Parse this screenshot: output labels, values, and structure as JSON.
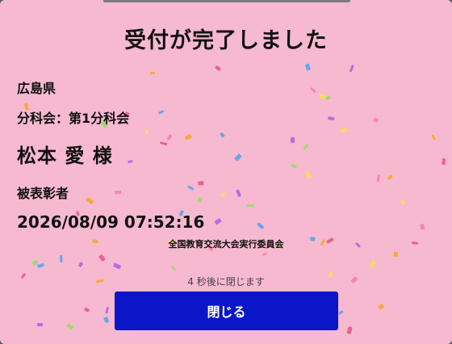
{
  "dialog": {
    "title": "受付が完了しました",
    "prefecture": "広島県",
    "section": "分科会：第1分科会",
    "name": "松本 愛 様",
    "award": "被表彰者",
    "datetime": "2026/08/09 07:52:16",
    "organizer": "全国教育交流大会実行委員会",
    "countdown": "4 秒後に閉じます",
    "close_label": "閉じる"
  },
  "colors": {
    "background": "#f7b9d0",
    "button": "#0a16c8",
    "confetti": [
      "#f5a623",
      "#e94f8a",
      "#4aa3f0",
      "#b05ce8",
      "#8ee05a",
      "#f6e24a",
      "#ff7aa8"
    ]
  }
}
